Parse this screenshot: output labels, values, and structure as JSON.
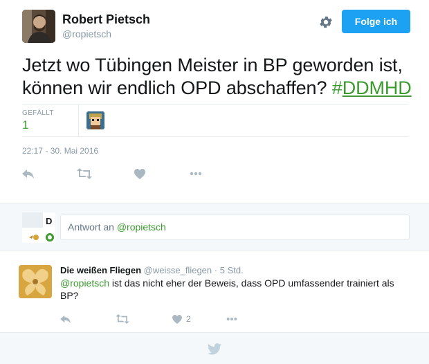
{
  "author": {
    "name": "Robert Pietsch",
    "screen_name": "@ropietsch"
  },
  "follow_button": {
    "label": "Folge ich"
  },
  "tweet": {
    "text": "Jetzt wo Tübingen Meister in BP geworden ist, können wir endlich OPD abschaffen?",
    "hashtag_symbol": "#",
    "hashtag": "DDMHD"
  },
  "stats": {
    "likes_label": "GEFÄLLT",
    "likes_count": "1"
  },
  "timestamp": "22:17 - 30. Mai 2016",
  "actions": [
    "reply-icon",
    "retweet-icon",
    "heart-icon",
    "more-icon"
  ],
  "reply_box": {
    "prefix": "Antwort an ",
    "mention": "@ropietsch"
  },
  "reply_tweet": {
    "name": "Die weißen Fliegen",
    "screen_name": "@weisse_fliegen",
    "separator": "·",
    "time": "5 Std.",
    "mention": "@ropietsch",
    "text": " ist das nicht eher der Beweis, dass OPD umfassender trainiert als BP?",
    "like_count": "2"
  },
  "colors": {
    "accent_green": "#3b9b2f",
    "follow_blue": "#1da1f2",
    "muted": "#8899a6",
    "icon_gray": "#aab8c2"
  }
}
